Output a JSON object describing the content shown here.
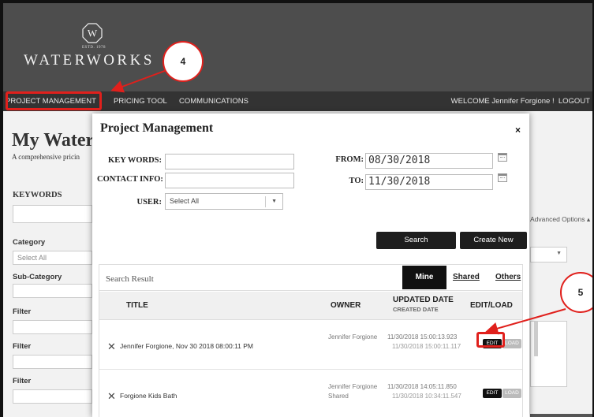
{
  "logo": {
    "estd": "ESTD. 1978",
    "wordmark": "WATERWORKS"
  },
  "nav": {
    "items": [
      "PROJECT MANAGEMENT",
      "PRICING TOOL",
      "COMMUNICATIONS"
    ],
    "welcome_prefix": "WELCOME ",
    "user_name": "Jennifer Forgione !",
    "logout": "LOGOUT"
  },
  "background_page": {
    "title": "My Water",
    "subtitle": "A comprehensive pricin",
    "keywords_heading": "KEYWORDS",
    "category_label": "Category",
    "category_value": "Select All",
    "subcategory_label": "Sub-Category",
    "filter_labels": [
      "Filter",
      "Filter",
      "Filter"
    ],
    "advanced_options": "Advanced Options ▴"
  },
  "modal": {
    "title": "Project Management",
    "close": "×",
    "form": {
      "keywords_label": "KEY WORDS:",
      "keywords_value": "",
      "contact_label": "CONTACT INFO:",
      "contact_value": "",
      "user_label": "USER:",
      "user_value": "Select All",
      "from_label": "FROM:",
      "from_value": "08/30/2018",
      "to_label": "TO:",
      "to_value": "11/30/2018"
    },
    "buttons": {
      "search": "Search",
      "create_new": "Create New"
    },
    "results": {
      "label": "Search Result",
      "tabs": {
        "mine": "Mine",
        "shared": "Shared",
        "others": "Others"
      },
      "columns": {
        "title": "TITLE",
        "owner": "OWNER",
        "updated": "UPDATED DATE",
        "created": "CREATED DATE",
        "edit_load": "EDIT/LOAD"
      },
      "rows": [
        {
          "title": "Jennifer Forgione, Nov 30 2018 08:00:11 PM",
          "owner": "Jennifer Forgione",
          "shared": "",
          "updated": "11/30/2018 15:00:13.923",
          "created": "11/30/2018 15:00:11.117",
          "edit": "EDIT",
          "load": "LOAD"
        },
        {
          "title": "Forgione Kids Bath",
          "owner": "Jennifer Forgione",
          "shared": "Shared",
          "updated": "11/30/2018 14:05:11.850",
          "created": "11/30/2018 10:34:11.547",
          "edit": "EDIT",
          "load": "LOAD"
        }
      ]
    }
  },
  "annotations": {
    "step4": "4",
    "step5": "5",
    "color": "#e0201c"
  }
}
